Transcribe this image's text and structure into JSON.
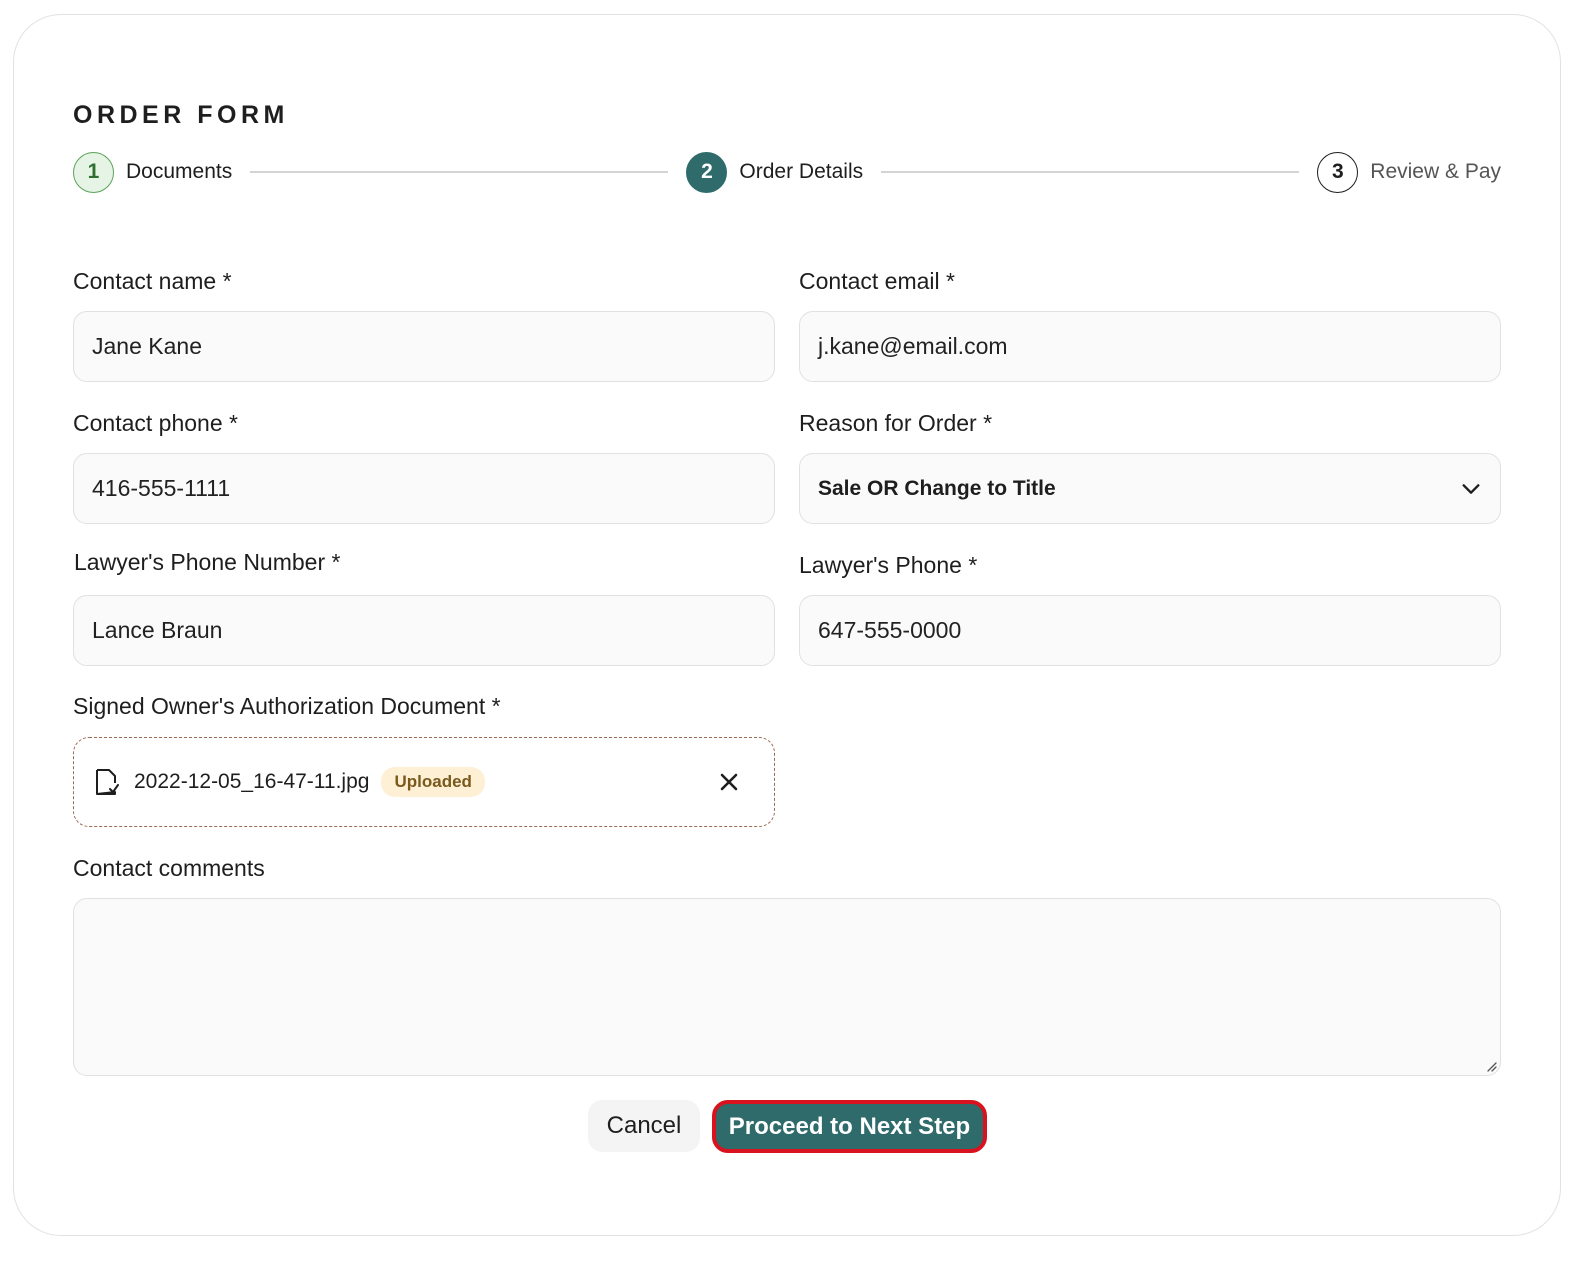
{
  "form": {
    "title": "ORDER FORM"
  },
  "stepper": {
    "steps": [
      {
        "number": "1",
        "label": "Documents",
        "state": "completed"
      },
      {
        "number": "2",
        "label": "Order Details",
        "state": "active"
      },
      {
        "number": "3",
        "label": "Review & Pay",
        "state": "upcoming"
      }
    ]
  },
  "fields": {
    "contact_name": {
      "label": "Contact name *",
      "value": "Jane Kane"
    },
    "contact_email": {
      "label": "Contact email *",
      "value": "j.kane@email.com"
    },
    "contact_phone": {
      "label": "Contact phone *",
      "value": "416-555-1111"
    },
    "reason": {
      "label": "Reason for Order *",
      "selected": "Sale OR Change to Title"
    },
    "lawyer_name": {
      "label": "Lawyer's Phone Number *",
      "value": "Lance Braun"
    },
    "lawyer_phone": {
      "label": "Lawyer's Phone *",
      "value": "647-555-0000"
    },
    "authorization": {
      "label": "Signed Owner's Authorization Document *",
      "file_name": "2022-12-05_16-47-11.jpg",
      "status": "Uploaded"
    },
    "comments": {
      "label": "Contact comments",
      "value": ""
    }
  },
  "actions": {
    "cancel_label": "Cancel",
    "next_label": "Proceed to Next Step"
  },
  "colors": {
    "primary": "#2f6b6b",
    "highlight_border": "#d8121e",
    "step_done_bg": "#e6f4e6",
    "badge_bg": "#fdf0d4"
  },
  "icons": {
    "file": "file-check-icon",
    "remove": "close-icon",
    "dropdown": "chevron-down-icon"
  }
}
